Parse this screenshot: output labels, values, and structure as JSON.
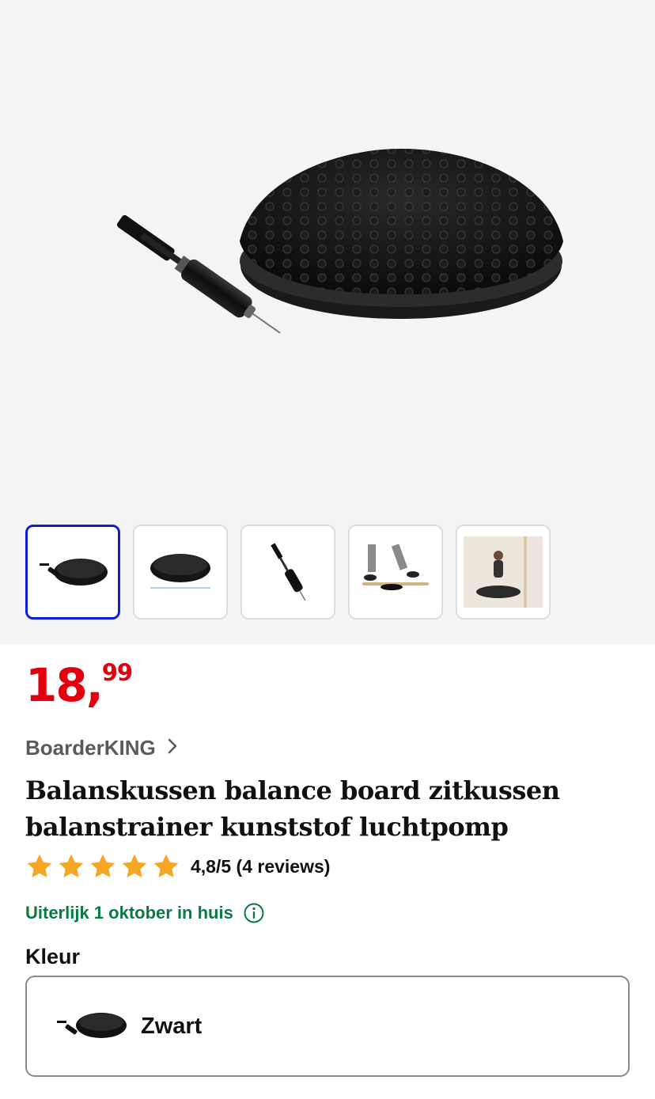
{
  "gallery": {
    "thumbnails": [
      {
        "icon": "cushion-with-pump-thumbnail",
        "active": true
      },
      {
        "icon": "cushion-dimensions-thumbnail",
        "active": false
      },
      {
        "icon": "pump-thumbnail",
        "active": false
      },
      {
        "icon": "balance-board-feet-thumbnail",
        "active": false
      },
      {
        "icon": "yoga-woman-thumbnail",
        "active": false
      }
    ]
  },
  "product": {
    "price_main": "18,",
    "price_cents": "99",
    "brand": "BoarderKING",
    "title": "Balanskussen balance board zitkussen balanstrainer kunststof luchtpomp",
    "rating": {
      "value": 4.8,
      "max": 5,
      "text": "4,8/5 (4 reviews)"
    },
    "delivery": "Uiterlijk 1 oktober in huis",
    "color_label": "Kleur",
    "color_option": "Zwart"
  },
  "colors": {
    "price": "#e2000f",
    "delivery": "#0a7a45",
    "active_thumb_border": "#0a1fd6",
    "star": "#f5a623"
  }
}
